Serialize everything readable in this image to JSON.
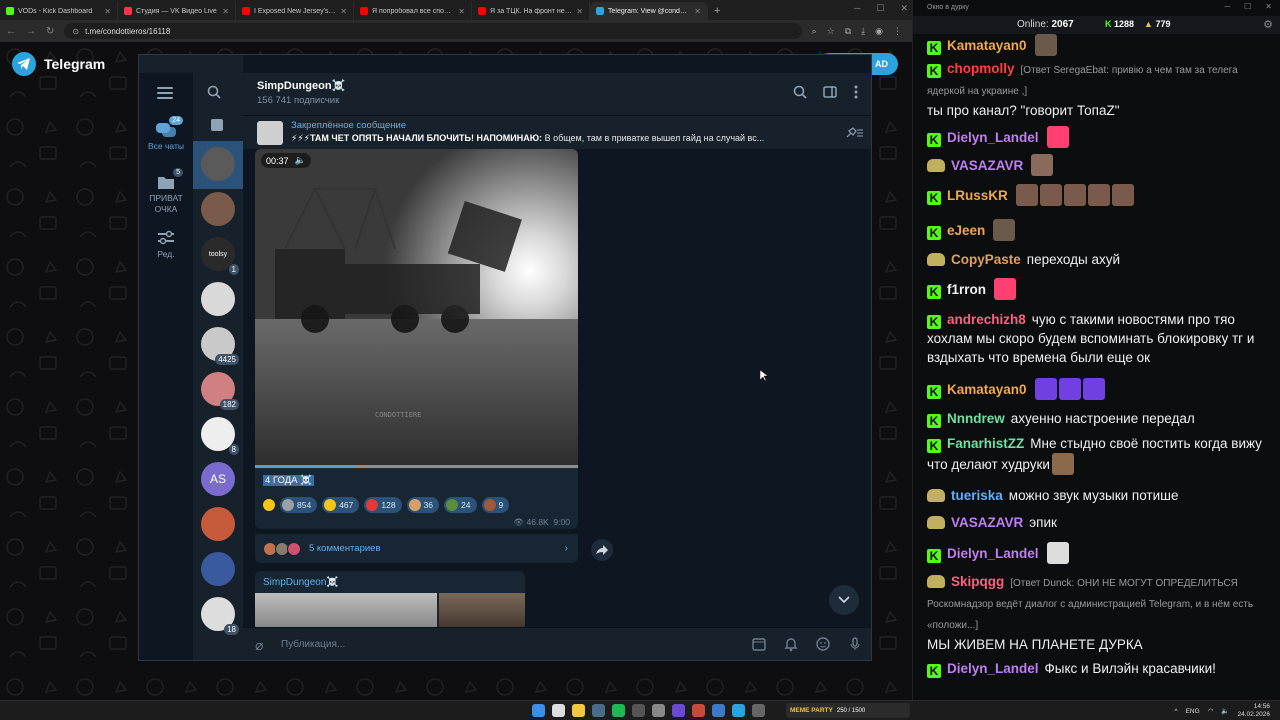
{
  "browser": {
    "tabs": [
      {
        "title": "VODs - Kick Dashboard",
        "color": "#53fc18"
      },
      {
        "title": "Студия — VK Видео Live",
        "color": "#ff3347"
      },
      {
        "title": "I Exposed New Jersey's Jewish",
        "color": "#ff0000"
      },
      {
        "title": "Я попробовал все способы б...",
        "color": "#ff0000"
      },
      {
        "title": "Я за ТЦК. На фронт не хочу. С...",
        "color": "#ff0000"
      },
      {
        "title": "Telegram: View @condottieros",
        "color": "#2aa3de"
      }
    ],
    "active_tab_index": 5,
    "new_tab_symbol": "+",
    "url": "t.me/condottieros/16118"
  },
  "tg_page": {
    "brand": "Telegram",
    "pill_label": "AD"
  },
  "telegram": {
    "folders": [
      {
        "label": "Все чаты",
        "badge": "24",
        "icon": "chat-bubbles-icon"
      },
      {
        "label": "ПРИВАТ ОЧКА",
        "badge": "5",
        "icon": "folder-icon"
      },
      {
        "label": "Ред.",
        "badge": "",
        "icon": "sliders-icon"
      }
    ],
    "chats": [
      {
        "color": "#5a5a5a",
        "count": ""
      },
      {
        "color": "#7a5a4a",
        "count": ""
      },
      {
        "color": "#2a2a2a",
        "count": "1",
        "text": "toolsy"
      },
      {
        "color": "#d9d9d9",
        "count": ""
      },
      {
        "color": "#c9c9c9",
        "count": "4425"
      },
      {
        "color": "#d08080",
        "count": "182"
      },
      {
        "color": "#eeeeee",
        "count": "8"
      },
      {
        "color": "#7b6bd0",
        "count": "",
        "text": "AS"
      },
      {
        "color": "#c75a3a",
        "count": ""
      },
      {
        "color": "#3a5aa0",
        "count": ""
      },
      {
        "color": "#dddddd",
        "count": "18"
      }
    ],
    "channel": {
      "name": "SimpDungeon☠️",
      "subscribers": "156 741 подписчик"
    },
    "pinned": {
      "title": "Закреплённое сообщение",
      "bold": "⚡⚡⚡ТАМ ЧЕТ ОПЯТЬ НАЧАЛИ БЛОЧИТЬ! НАПОМИНАЮ:",
      "text": "В общем, там в приватке вышел гайд на случай вс..."
    },
    "post": {
      "duration": "00:37",
      "progress": 0.31,
      "caption": "4 ГОДА ☠️",
      "watermark": "CONDOTTIERE",
      "reactions": [
        {
          "count": "",
          "color": "#f5c518"
        },
        {
          "count": "854",
          "color": "#9aa0a6"
        },
        {
          "count": "467",
          "color": "#f5c518"
        },
        {
          "count": "128",
          "color": "#e53935"
        },
        {
          "count": "36",
          "color": "#d9a066"
        },
        {
          "count": "24",
          "color": "#5e8c3a"
        },
        {
          "count": "9",
          "color": "#a05a3a"
        }
      ],
      "views": "46.8K",
      "time": "9:00",
      "comments": "5 комментариев"
    },
    "next_post_author": "SimpDungeon☠️",
    "composer_placeholder": "Публикация..."
  },
  "chat_panel": {
    "title": "Окно в дурку",
    "online_label": "Online:",
    "online": "2067",
    "kick_viewers": "1288",
    "other_viewers": "779",
    "messages": [
      {
        "badge": "kick",
        "user": "Kamatayan0",
        "color": "#f0a84a",
        "text": "",
        "emotes": [
          "#6a5a4a"
        ]
      },
      {
        "badge": "kick",
        "user": "chopmolly",
        "color": "#ff4040",
        "reply": "[Ответ SeregaEbat: привію а чем там за телега ядеркой на украине ,]",
        "text": "ты про канал? \"говорит ТопаZ\""
      },
      {
        "badge": "kick",
        "user": "Dielyn_Landel",
        "color": "#c07ff0",
        "text": "",
        "emotes": [
          "#ff4070"
        ]
      },
      {
        "badge": "bot",
        "user": "VASAZAVR",
        "color": "#c07ff0",
        "text": "",
        "emotes": [
          "#8a6a5a"
        ]
      },
      {
        "badge": "kick",
        "user": "LRussKR",
        "color": "#f0a84a",
        "text": "",
        "emotes": [
          "#7a5a4a",
          "#7a5a4a",
          "#7a5a4a",
          "#7a5a4a",
          "#7a5a4a"
        ]
      },
      {
        "badge": "kick",
        "user": "eJeen",
        "color": "#f0a84a",
        "text": "",
        "emotes": [
          "#6a5a4a"
        ]
      },
      {
        "badge": "bot",
        "user": "CopyPaste",
        "color": "#e0a060",
        "text": "переходы ахуй"
      },
      {
        "badge": "kick",
        "user": "f1rron",
        "color": "#f0f0f0",
        "text": "",
        "emotes": [
          "#ff4070"
        ]
      },
      {
        "badge": "kick",
        "user": "andrechizh8",
        "color": "#ff6080",
        "text": "чую с такими новостями про тяо хохлам мы скоро будем вспоминать блокировку тг и вздыхать что времена были еще ок"
      },
      {
        "badge": "kick",
        "user": "Kamatayan0",
        "color": "#f0a84a",
        "text": "",
        "emotes": [
          "#7040e0",
          "#7040e0",
          "#7040e0"
        ]
      },
      {
        "badge": "kick",
        "user": "Nnndrew",
        "color": "#70e0a0",
        "text": "ахуенно настроение передал"
      },
      {
        "badge": "kick",
        "user": "FanarhistZZ",
        "color": "#70e0a0",
        "text": "Мне стыдно своё постить когда вижу что делают худруки",
        "emotes": [
          "#8a6a4a"
        ]
      },
      {
        "badge": "bot",
        "user": "tueriska",
        "color": "#60b0ff",
        "text": "можно звук музыки потише"
      },
      {
        "badge": "bot",
        "user": "VASAZAVR",
        "color": "#c07ff0",
        "text": "эпик"
      },
      {
        "badge": "kick",
        "user": "Dielyn_Landel",
        "color": "#c07ff0",
        "text": "",
        "emotes": [
          "#dddddd"
        ]
      },
      {
        "badge": "bot",
        "user": "Skipqgg",
        "color": "#ff6080",
        "reply": "[Ответ Dunck: ОНИ НЕ МОГУТ ОПРЕДЕЛИТЬСЯ  Роскомнадзор ведёт диалог с администрацией Telegram, и в нём есть «положи...]",
        "text": "МЫ ЖИВЕМ НА ПЛАНЕТЕ ДУРКА"
      },
      {
        "badge": "kick",
        "user": "Dielyn_Landel",
        "color": "#c07ff0",
        "text": "Фыкс и Вилэйн красавчики!"
      }
    ]
  },
  "taskbar": {
    "meme_label": "MEME PARTY",
    "meme_value": "250 / 1500",
    "lang": "ENG",
    "time": "14:56",
    "date": "24.02.2026"
  }
}
